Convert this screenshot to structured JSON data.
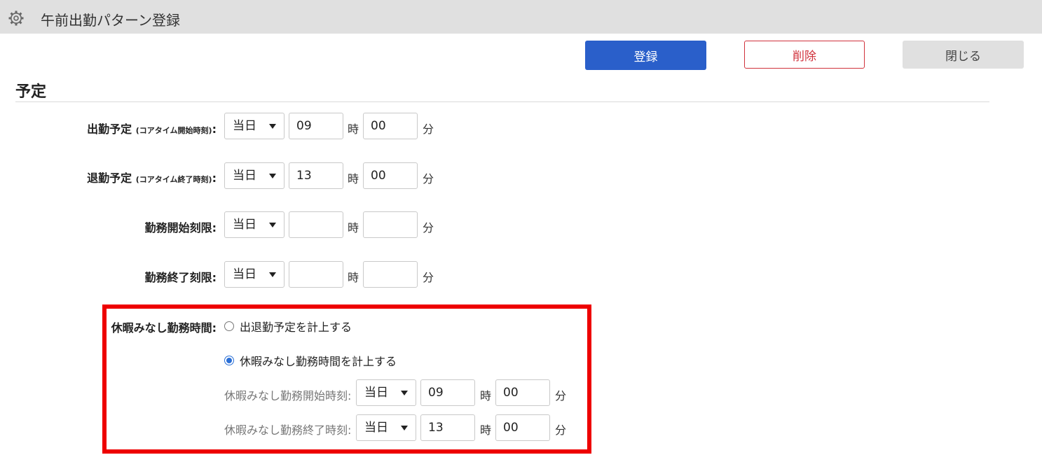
{
  "window": {
    "title": "午前出勤パターン登録",
    "icon": "gear-icon"
  },
  "toolbar": {
    "register_label": "登録",
    "delete_label": "削除",
    "close_label": "閉じる"
  },
  "section": {
    "title": "予定"
  },
  "rows": [
    {
      "label": "出勤予定",
      "note": "(コアタイム開始時刻)",
      "colon": ":",
      "day": "当日",
      "hour": "09",
      "minute": "00"
    },
    {
      "label": "退勤予定",
      "note": "(コアタイム終了時刻)",
      "colon": ":",
      "day": "当日",
      "hour": "13",
      "minute": "00"
    },
    {
      "label": "勤務開始刻限:",
      "day": "当日",
      "hour": "",
      "minute": ""
    },
    {
      "label": "勤務終了刻限:",
      "day": "当日",
      "hour": "",
      "minute": ""
    }
  ],
  "units": {
    "hour": "時",
    "minute": "分"
  },
  "leave": {
    "label": "休暇みなし勤務時間:",
    "option1": "出退勤予定を計上する",
    "option2": "休暇みなし勤務時間を計上する",
    "selected": "option2",
    "start": {
      "label": "休暇みなし勤務開始時刻:",
      "day": "当日",
      "hour": "09",
      "minute": "00"
    },
    "end": {
      "label": "休暇みなし勤務終了時刻:",
      "day": "当日",
      "hour": "13",
      "minute": "00"
    }
  },
  "colors": {
    "primary": "#2a5fca",
    "danger": "#d0323c",
    "highlight": "#ee0000"
  }
}
